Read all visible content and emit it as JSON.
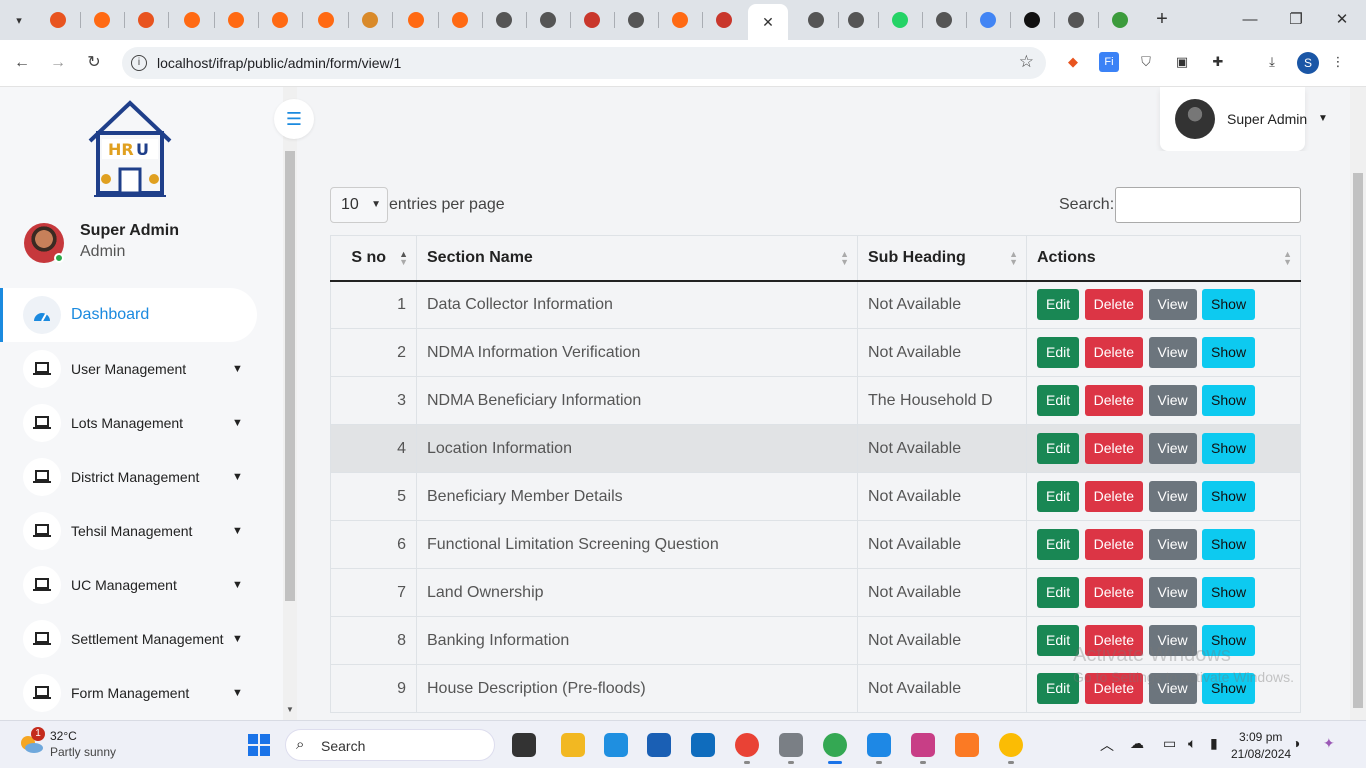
{
  "browser": {
    "url": "localhost/ifrap/public/admin/form/view/1",
    "tab_favicon_colors": [
      "#e8541f",
      "#ff6a13",
      "#e8541f",
      "#ff6a13",
      "#ff6a13",
      "#ff6a13",
      "#ff6a13",
      "#d98a2a",
      "#ff6a13",
      "#ff6a13",
      "#555",
      "#555",
      "#c9372c",
      "#555",
      "#ff6a13",
      "#c9372c",
      "#555",
      "#555",
      "#555",
      "#25d366",
      "#555",
      "#4285f4",
      "#111",
      "#555",
      "#3c9b3c"
    ],
    "profile_initial": "S"
  },
  "sidebar": {
    "user_name": "Super Admin",
    "user_role": "Admin",
    "items": [
      {
        "label": "Dashboard",
        "icon": "gauge-icon",
        "active": true
      },
      {
        "label": "User Management",
        "icon": "laptop-icon"
      },
      {
        "label": "Lots Management",
        "icon": "laptop-icon"
      },
      {
        "label": "District Management",
        "icon": "laptop-icon"
      },
      {
        "label": "Tehsil Management",
        "icon": "laptop-icon"
      },
      {
        "label": "UC Management",
        "icon": "laptop-icon"
      },
      {
        "label": "Settlement Management",
        "icon": "laptop-icon"
      },
      {
        "label": "Form Management",
        "icon": "laptop-icon"
      }
    ]
  },
  "topbar": {
    "user_name": "Super Admin"
  },
  "table_controls": {
    "length_value": "10",
    "length_label": "entries per page",
    "search_label": "Search:"
  },
  "table": {
    "headers": [
      "S no",
      "Section Name",
      "Sub Heading",
      "Actions"
    ],
    "actions": {
      "edit": "Edit",
      "delete": "Delete",
      "view": "View",
      "show": "Show"
    },
    "rows": [
      {
        "sno": "1",
        "section": "Data Collector Information",
        "sub": "Not Available"
      },
      {
        "sno": "2",
        "section": "NDMA Information Verification",
        "sub": "Not Available"
      },
      {
        "sno": "3",
        "section": "NDMA Beneficiary Information",
        "sub": "The Household D"
      },
      {
        "sno": "4",
        "section": "Location Information",
        "sub": "Not Available"
      },
      {
        "sno": "5",
        "section": "Beneficiary Member Details",
        "sub": "Not Available"
      },
      {
        "sno": "6",
        "section": "Functional Limitation Screening Question",
        "sub": "Not Available"
      },
      {
        "sno": "7",
        "section": "Land Ownership",
        "sub": "Not Available"
      },
      {
        "sno": "8",
        "section": "Banking Information",
        "sub": "Not Available"
      },
      {
        "sno": "9",
        "section": "House Description (Pre-floods)",
        "sub": "Not Available"
      }
    ]
  },
  "watermark": {
    "line1": "Activate Windows",
    "line2": "Go to Settings to activate Windows."
  },
  "taskbar": {
    "badge": "1",
    "temperature": "32°C",
    "condition": "Partly sunny",
    "search_placeholder": "Search",
    "time": "3:09 pm",
    "date": "21/08/2024"
  },
  "colors": {
    "accent": "#1b8adf",
    "edit": "#198754",
    "delete": "#dc3545",
    "view": "#6c757d",
    "show": "#0dcaf0"
  }
}
